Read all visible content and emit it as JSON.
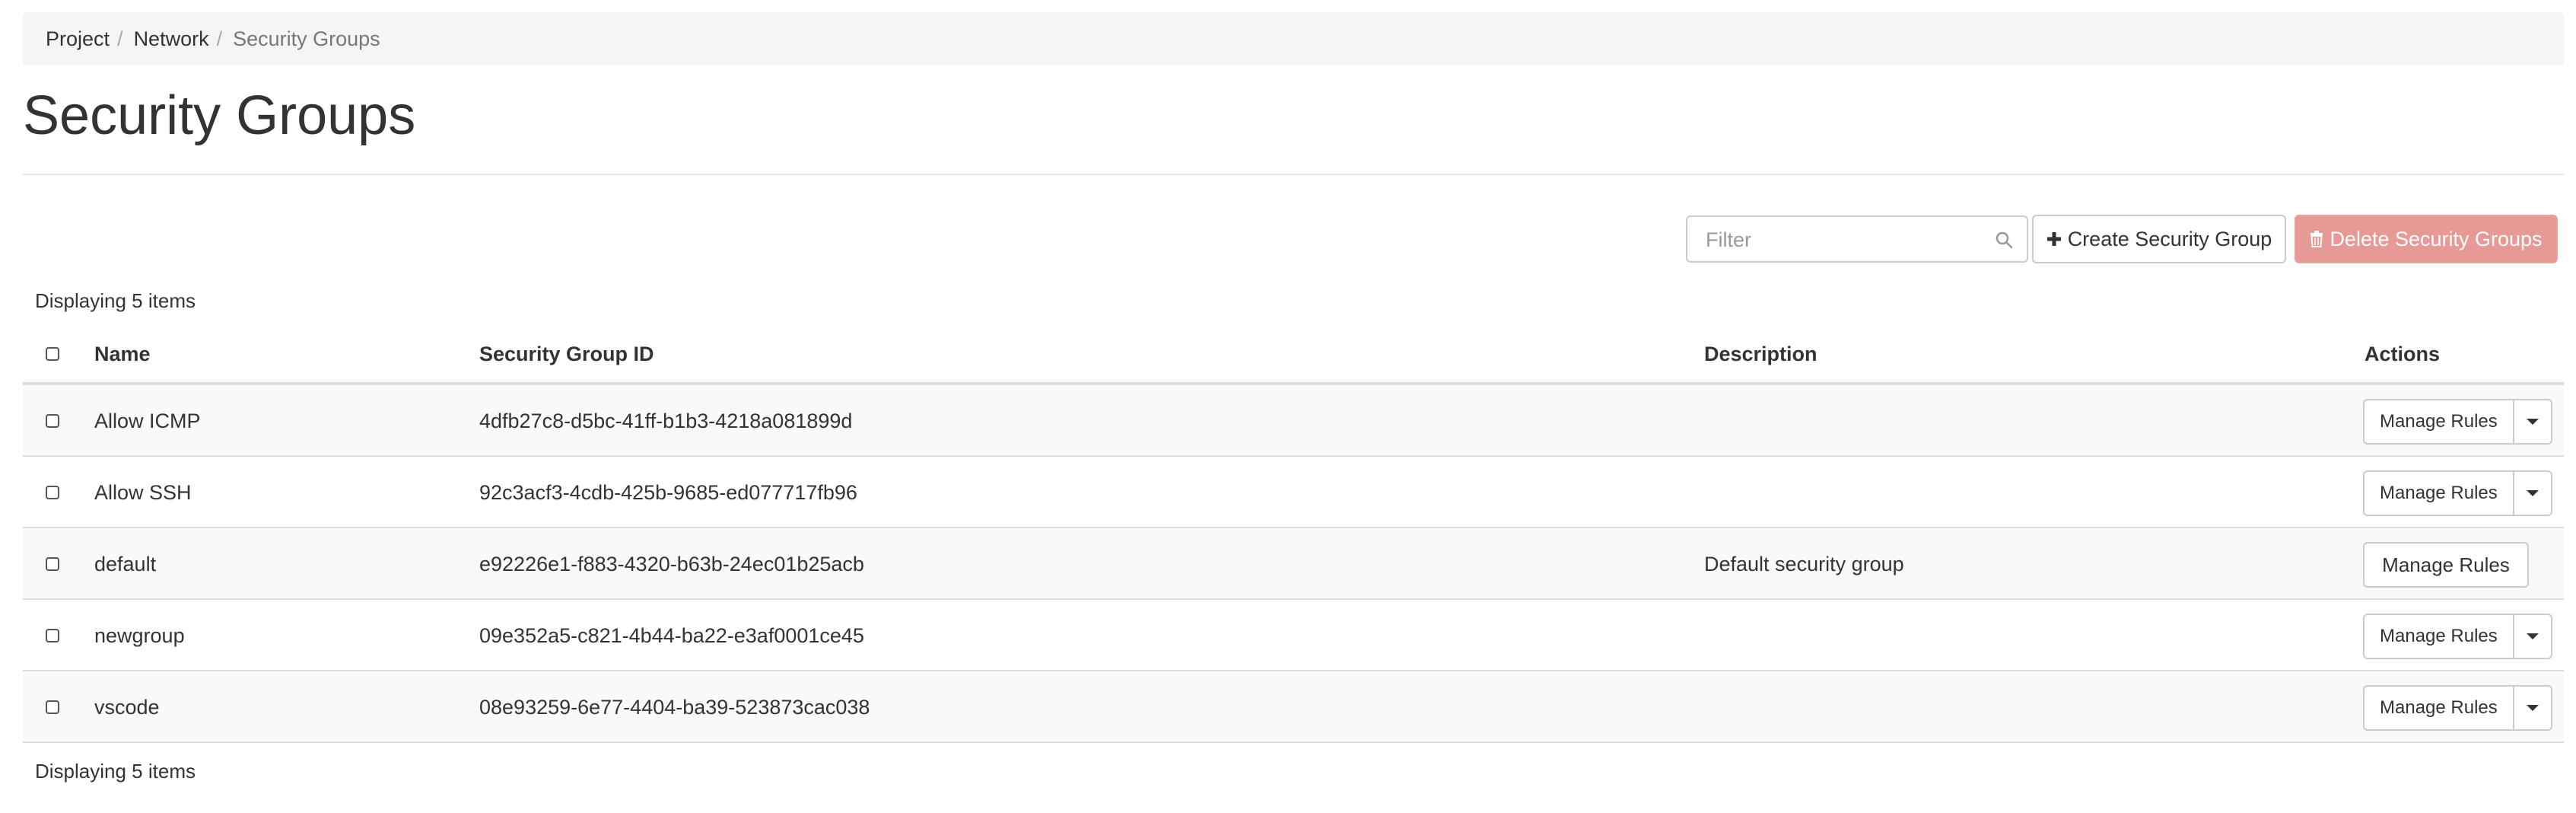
{
  "breadcrumb": {
    "items": [
      "Project",
      "Network",
      "Security Groups"
    ],
    "separator": "/"
  },
  "page_title": "Security Groups",
  "toolbar": {
    "filter_placeholder": "Filter",
    "create_label": "Create Security Group",
    "delete_label": "Delete Security Groups",
    "create_icon": "plus-icon",
    "delete_icon": "trash-icon"
  },
  "count_text_top": "Displaying 5 items",
  "count_text_bottom": "Displaying 5 items",
  "table": {
    "headers": {
      "name": "Name",
      "id": "Security Group ID",
      "description": "Description",
      "actions": "Actions"
    },
    "rows": [
      {
        "name": "Allow ICMP",
        "id": "4dfb27c8-d5bc-41ff-b1b3-4218a081899d",
        "description": "",
        "action": "Manage Rules",
        "has_dropdown": true
      },
      {
        "name": "Allow SSH",
        "id": "92c3acf3-4cdb-425b-9685-ed077717fb96",
        "description": "",
        "action": "Manage Rules",
        "has_dropdown": true
      },
      {
        "name": "default",
        "id": "e92226e1-f883-4320-b63b-24ec01b25acb",
        "description": "Default security group",
        "action": "Manage Rules",
        "has_dropdown": false
      },
      {
        "name": "newgroup",
        "id": "09e352a5-c821-4b44-ba22-e3af0001ce45",
        "description": "",
        "action": "Manage Rules",
        "has_dropdown": true
      },
      {
        "name": "vscode",
        "id": "08e93259-6e77-4404-ba39-523873cac038",
        "description": "",
        "action": "Manage Rules",
        "has_dropdown": true
      }
    ]
  },
  "colors": {
    "danger_button": "#e79996",
    "breadcrumb_bg": "#f5f5f5",
    "row_stripe": "#f9f9f9"
  }
}
